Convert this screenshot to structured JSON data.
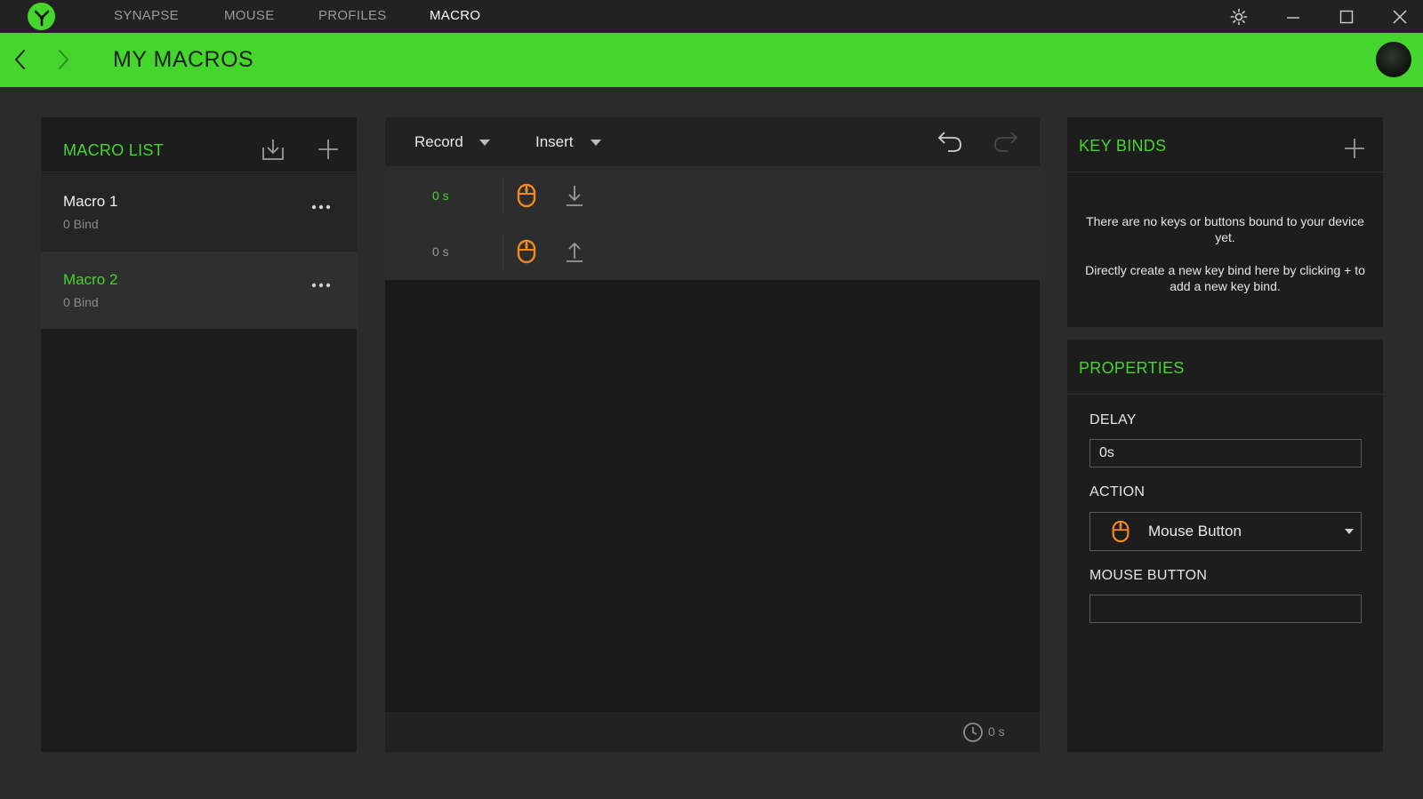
{
  "topnav": {
    "items": [
      "SYNAPSE",
      "MOUSE",
      "PROFILES",
      "MACRO"
    ],
    "active": "MACRO"
  },
  "header": {
    "title": "MY MACROS"
  },
  "macro_list": {
    "title": "MACRO LIST",
    "items": [
      {
        "name": "Macro 1",
        "bind": "0 Bind",
        "selected": false
      },
      {
        "name": "Macro 2",
        "bind": "0 Bind",
        "selected": true
      }
    ]
  },
  "editor": {
    "record_label": "Record",
    "insert_label": "Insert",
    "rows": [
      {
        "time": "0 s",
        "icon": "mouse-icon",
        "action": "button-down-icon",
        "selected": true
      },
      {
        "time": "0 s",
        "icon": "mouse-icon",
        "action": "button-up-icon",
        "selected": false
      }
    ],
    "total_time": "0 s"
  },
  "key_binds": {
    "title": "KEY BINDS",
    "message_1": "There are no keys or buttons bound to your device yet.",
    "message_2": "Directly create a new key bind here by clicking + to add a new key bind."
  },
  "properties": {
    "title": "PROPERTIES",
    "delay_label": "DELAY",
    "delay_value": "0s",
    "action_label": "ACTION",
    "action_value": "Mouse Button",
    "mouse_button_label": "MOUSE BUTTON",
    "mouse_button_value": ""
  },
  "colors": {
    "accent": "#44d62c",
    "mouse_icon": "#f08a1c"
  }
}
